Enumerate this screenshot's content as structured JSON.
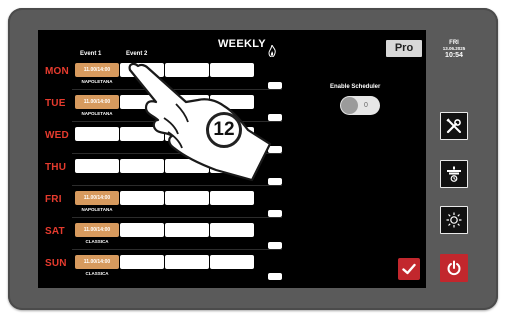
{
  "screen_title": "WEEKLY",
  "pro_label": "Pro",
  "event_headers": [
    "Event 1",
    "Event 2"
  ],
  "schedule": {
    "label": "Enable Scheduler",
    "state": "0"
  },
  "datetime": {
    "day": "FRI",
    "date": "13.06.2025",
    "time": "10:54"
  },
  "callout_number": "12",
  "days": [
    {
      "name": "MON",
      "slot_time": "11.00/14:00",
      "program": "NAPOLETANA"
    },
    {
      "name": "TUE",
      "slot_time": "11.00/14:00",
      "program": "NAPOLETANA"
    },
    {
      "name": "WED",
      "slot_time": "",
      "program": ""
    },
    {
      "name": "THU",
      "slot_time": "",
      "program": ""
    },
    {
      "name": "FRI",
      "slot_time": "11.00/14:00",
      "program": "NAPOLETANA"
    },
    {
      "name": "SAT",
      "slot_time": "11.00/14:00",
      "program": "CLASSICA"
    },
    {
      "name": "SUN",
      "slot_time": "11.00/14:00",
      "program": "CLASSICA"
    }
  ],
  "colors": {
    "day_label": "#e63b2e",
    "active_slot": "#d79a5e",
    "power": "#c2272d"
  },
  "icons": {
    "settings": "tools-icon",
    "oven": "oven-icon",
    "light": "light-icon",
    "power": "power-icon",
    "confirm": "checkmark-icon",
    "flame": "flame-icon"
  }
}
